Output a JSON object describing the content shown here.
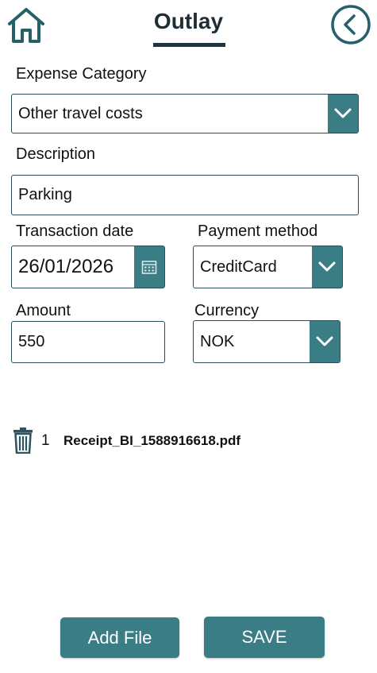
{
  "header": {
    "title": "Outlay",
    "home_icon": "home-icon",
    "back_icon": "chevron-left-circle-icon"
  },
  "form": {
    "expense_category": {
      "label": "Expense Category",
      "value": "Other travel costs"
    },
    "description": {
      "label": "Description",
      "value": "Parking"
    },
    "transaction_date": {
      "label": "Transaction date",
      "value": "26/01/2026",
      "icon": "calendar-icon"
    },
    "payment_method": {
      "label": "Payment method",
      "value": "CreditCard"
    },
    "amount": {
      "label": "Amount",
      "value": "550"
    },
    "currency": {
      "label": "Currency",
      "value": "NOK"
    }
  },
  "attachments": [
    {
      "index": "1",
      "filename": "Receipt_BI_1588916618.pdf",
      "icon": "trash-icon"
    }
  ],
  "buttons": {
    "add_file": "Add File",
    "save": "SAVE"
  },
  "colors": {
    "accent": "#3b7d85",
    "dark": "#1f3341",
    "border": "#2c4e5a"
  }
}
